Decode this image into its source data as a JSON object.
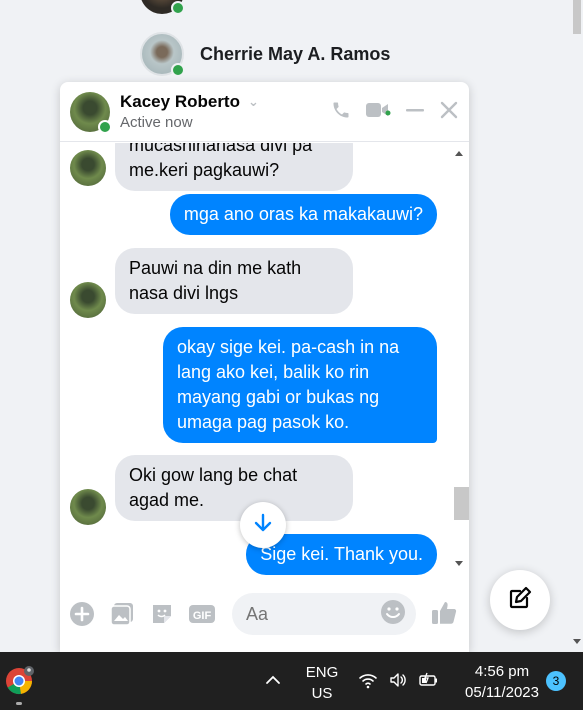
{
  "contacts": [
    {
      "name": ""
    },
    {
      "name": "Cherrie May A. Ramos"
    }
  ],
  "chat": {
    "name": "Kacey Roberto",
    "status": "Active now",
    "messages": [
      {
        "dir": "in",
        "text": "mucashinanasa divi pa me.keri pagkauwi?"
      },
      {
        "dir": "out",
        "text": "mga ano oras ka makakauwi?"
      },
      {
        "dir": "in",
        "text": "Pauwi na din me kath nasa divi lngs"
      },
      {
        "dir": "out",
        "text": "okay sige kei. pa-cash in na lang ako kei, balik ko rin mayang gabi  or bukas ng umaga pag pasok ko."
      },
      {
        "dir": "in",
        "text": "Oki gow lang be chat agad me."
      },
      {
        "dir": "out",
        "text": "Sige kei. Thank you."
      }
    ],
    "composer_placeholder": "Aa"
  },
  "taskbar": {
    "lang_line1": "ENG",
    "lang_line2": "US",
    "time": "4:56 pm",
    "date": "05/11/2023",
    "notifications": "3"
  },
  "colors": {
    "accent": "#0084ff",
    "online": "#31a24c",
    "incoming_bubble": "#e4e6eb"
  },
  "icons": [
    "phone-icon",
    "video-icon",
    "minimize-icon",
    "close-icon",
    "add-icon",
    "image-icon",
    "sticker-icon",
    "gif-icon",
    "emoji-icon",
    "like-icon",
    "new-message-icon",
    "arrow-down-icon"
  ]
}
